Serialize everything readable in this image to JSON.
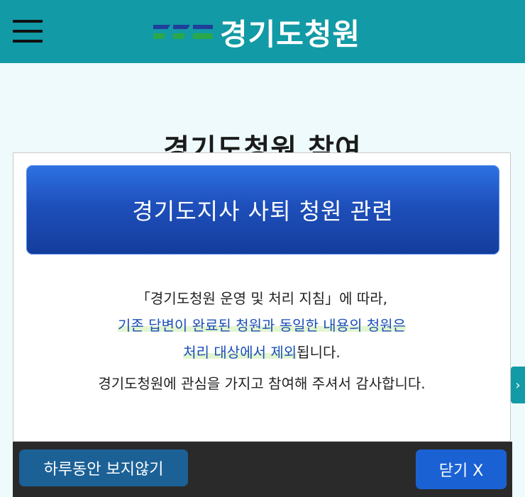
{
  "header": {
    "logo_text": "경기도청원",
    "bg_color": "#129aa6"
  },
  "page": {
    "section_title": "경기도청원 참여"
  },
  "popup": {
    "banner_title": "경기도지사 사퇴 청원 관련",
    "notice": {
      "line1": "「경기도청원 운영 및 처리 지침」에 따라,",
      "line2": "기존 답변이 완료된 청원과 동일한 내용의 청원은",
      "line3_highlight": "처리 대상에서 제외",
      "line3_rest": "됩니다.",
      "line4": "경기도청원에 관심을 가지고 참여해 주셔서 감사합니다."
    },
    "buttons": {
      "hide_today": "하루동안 보지않기",
      "close": "닫기 X"
    }
  },
  "icons": {
    "menu": "hamburger-icon",
    "side_tab": "chevron-right-icon"
  }
}
